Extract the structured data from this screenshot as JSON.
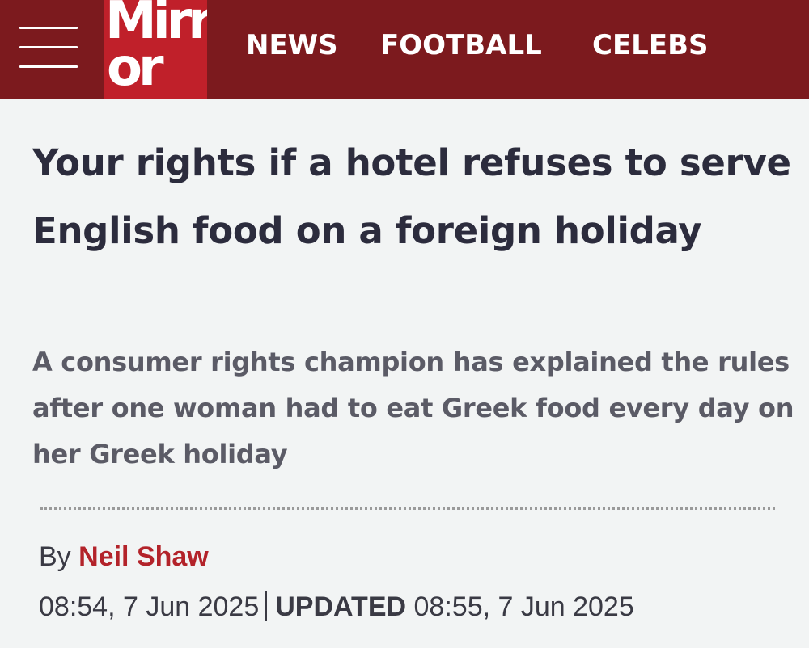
{
  "header": {
    "logo_line1": "Mirr",
    "logo_line2": "or",
    "menu_icon": "hamburger-menu-icon",
    "nav": [
      {
        "label": "NEWS"
      },
      {
        "label": "FOOTBALL"
      },
      {
        "label": "CELEBS"
      }
    ],
    "colors": {
      "bar": "#7c1a1e",
      "logo": "#c0202a"
    }
  },
  "article": {
    "headline": "Your rights if a hotel refuses to serve English food on a foreign holiday",
    "standfirst": "A consumer rights champion has explained the rules after one woman had to eat Greek food every day on her Greek holiday",
    "byline_prefix": "By",
    "author": "Neil Shaw",
    "published": "08:54, 7 Jun 2025",
    "updated_label": "UPDATED",
    "updated": "08:55, 7 Jun 2025"
  }
}
